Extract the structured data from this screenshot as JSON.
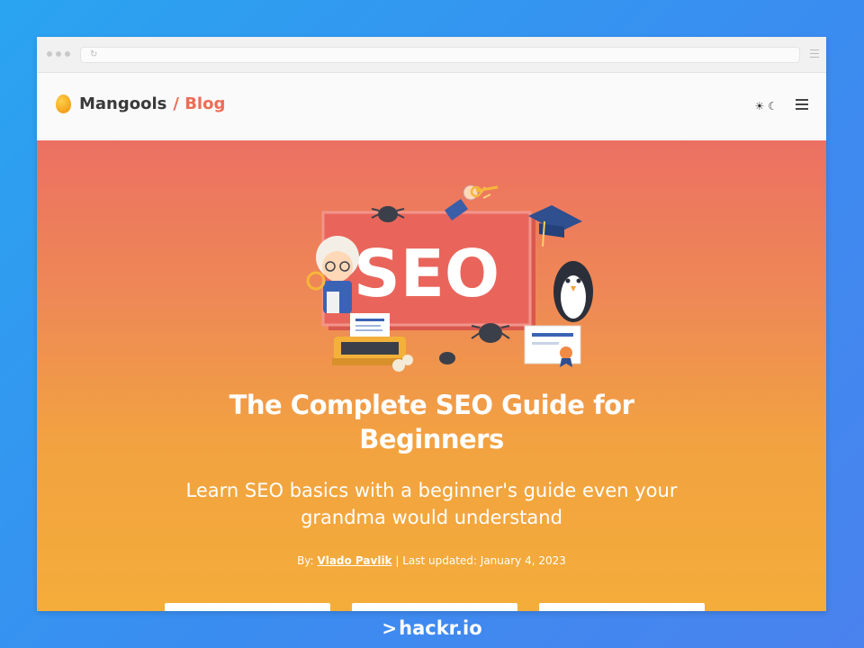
{
  "header": {
    "logo_name": "Mangools",
    "logo_section": "/ Blog",
    "theme_sun": "☀",
    "theme_moon": "☾"
  },
  "hero": {
    "illustration_text": "SEO",
    "title_line1": "The Complete SEO Guide for",
    "title_line2": "Beginners",
    "subtitle_line1": "Learn SEO basics with a beginner's guide even your",
    "subtitle_line2": "grandma would understand",
    "byline_prefix": "By:",
    "author": "Vlado Pavlik",
    "updated": "| Last updated: January 4, 2023"
  },
  "brand": {
    "chevron": ">",
    "name": "hackr.io"
  },
  "colors": {
    "accent": "#ee6b55",
    "hero_top": "#ec7062",
    "hero_bottom": "#f4ac3a",
    "background": "#2aa4f0"
  },
  "icons": [
    "reload-icon",
    "browser-menu-icon",
    "sun-icon",
    "moon-icon",
    "hamburger-icon",
    "mango-logo-icon"
  ]
}
